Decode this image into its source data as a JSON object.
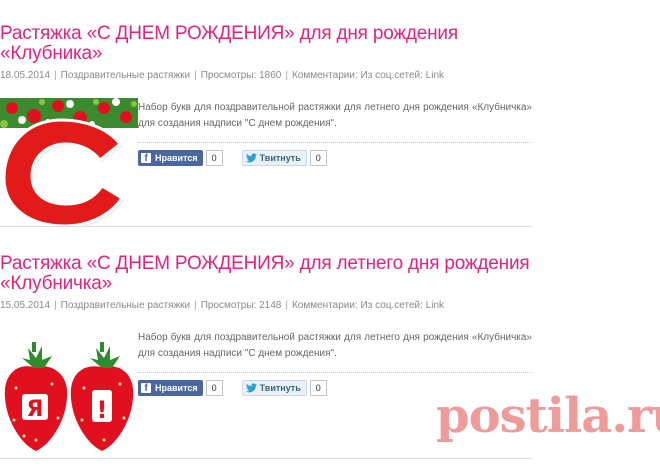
{
  "posts": [
    {
      "title": "Растяжка «С ДНЕМ РОЖДЕНИЯ» для дня рождения «Клубника»",
      "date": "18.05.2014",
      "category": "Поздравительные растяжки",
      "views": "Просмотры: 1860",
      "comments": "Комментарии: Из соц.сетей: Link",
      "description": "Набор букв для поздравительной растяжки для летнего дня рождения «Клубничка» для создания надписи \"С днем рождения\".",
      "like_label": "Нравится",
      "like_count": "0",
      "tweet_label": "Твитнуть",
      "tweet_count": "0",
      "thumb_letter": "С"
    },
    {
      "title": "Растяжка «С ДНЕМ РОЖДЕНИЯ» для летнего дня рождения «Клубничка»",
      "date": "15.05.2014",
      "category": "Поздравительные растяжки",
      "views": "Просмотры: 2148",
      "comments": "Комментарии: Из соц.сетей: Link",
      "description": "Набор букв для поздравительной растяжки для летнего дня рождения «Клубничка» для создания надписи \"С днем рождения\".",
      "like_label": "Нравится",
      "like_count": "0",
      "tweet_label": "Твитнуть",
      "tweet_count": "0",
      "thumb_letters": [
        "Я",
        "!"
      ]
    }
  ],
  "watermark": "postila.ru",
  "colors": {
    "title": "#e2237d",
    "facebook": "#4b67a1",
    "strawberry": "#e01020",
    "watermark": "#ec8a8a"
  }
}
